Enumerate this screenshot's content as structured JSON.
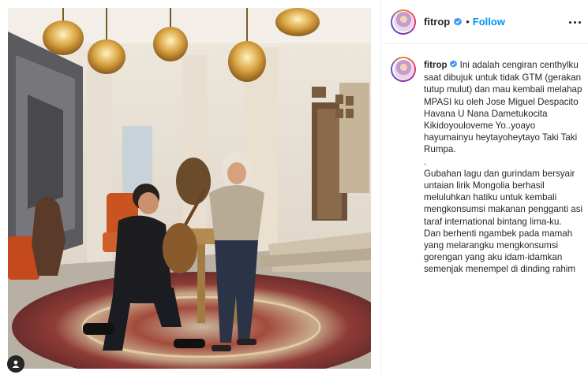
{
  "post": {
    "username": "fitrop",
    "verified": true,
    "follow_label": "Follow",
    "separator": "•",
    "more_icon": "more-horizontal-icon",
    "caption": {
      "username": "fitrop",
      "text": "Ini adalah cengiran centhylku saat dibujuk untuk tidak GTM (gerakan tutup mulut) dan mau kembali melahap MPASI ku oleh Jose Miguel Despacito Havana U Nana Dametukocita Kikidoyouloveme Yo..yoayo hayumainyu heytayoheytayo Taki Taki Rumpa.\n.\nGubahan lagu dan gurindam bersyair untaian lirik Mongolia berhasil meluluhkan hatiku untuk kembali mengkonsumsi makanan pengganti asi taraf international bintang lima-ku.\nDan berhenti ngambek pada mamah yang melarangku mengkonsumsi gorengan yang aku idam-idamkan semenjak menempel di dinding rahim"
    }
  },
  "colors": {
    "follow": "#0095f6",
    "text": "#262626",
    "divider": "#efefef",
    "verified": "#3897f0"
  },
  "icons": {
    "verified": "verified-badge-icon",
    "user_tag": "user-tag-icon"
  }
}
